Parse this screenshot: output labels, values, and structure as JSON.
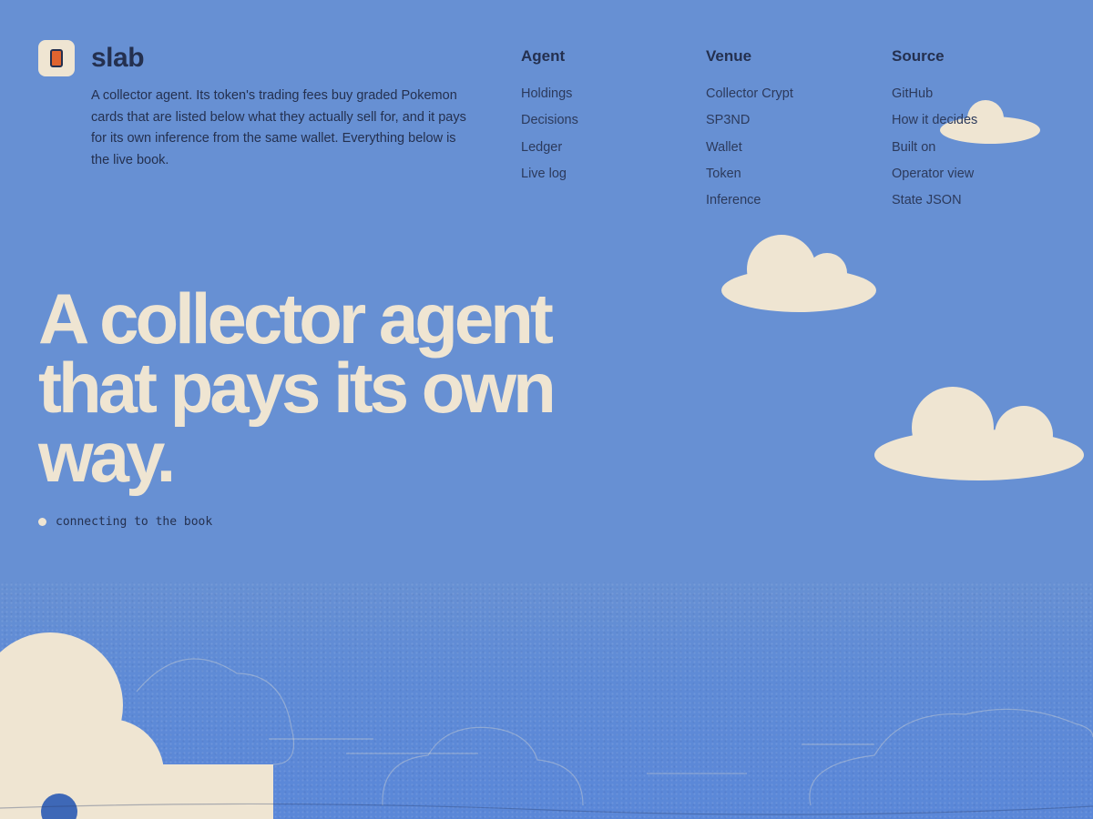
{
  "brand": {
    "name": "slab",
    "logo_icon": "card-icon",
    "intro": "A collector agent. Its token's trading fees buy graded Pokemon cards that are listed below what they actually sell for, and it pays for its own inference from the same wallet. Everything below is the live book."
  },
  "nav": {
    "agent": {
      "heading": "Agent",
      "links": [
        "Holdings",
        "Decisions",
        "Ledger",
        "Live log"
      ]
    },
    "venue": {
      "heading": "Venue",
      "links": [
        "Collector Crypt",
        "SP3ND",
        "Wallet",
        "Token",
        "Inference"
      ]
    },
    "source": {
      "heading": "Source",
      "links": [
        "GitHub",
        "How it decides",
        "Built on",
        "Operator view",
        "State JSON"
      ]
    }
  },
  "hero": {
    "line1": "A collector agent",
    "line2": "that pays its own",
    "line3": "way."
  },
  "status": {
    "text": "connecting to the book"
  },
  "colors": {
    "sky": "#6790d3",
    "cream": "#efe5d2",
    "ink": "#24304f",
    "accent": "#e0642f"
  }
}
